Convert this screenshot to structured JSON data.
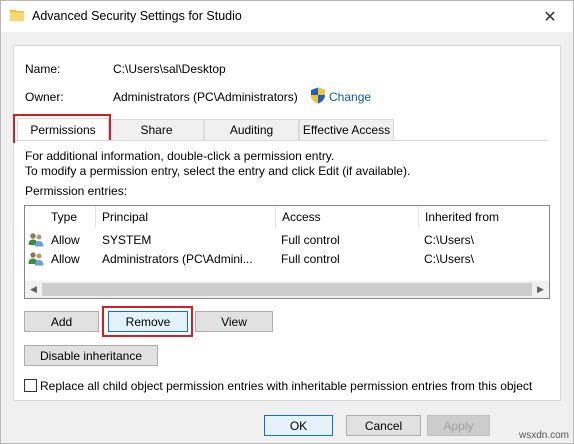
{
  "window": {
    "title": "Advanced Security Settings for Studio",
    "close_glyph": "✕"
  },
  "info": {
    "name_label": "Name:",
    "name_value": "C:\\Users\\sal\\Desktop",
    "owner_label": "Owner:",
    "owner_value": "Administrators (PC\\Administrators)",
    "change_link": "Change"
  },
  "tabs": [
    {
      "label": "Permissions",
      "active": true
    },
    {
      "label": "Share",
      "active": false
    },
    {
      "label": "Auditing",
      "active": false
    },
    {
      "label": "Effective Access",
      "active": false
    }
  ],
  "permissions": {
    "info_line1": "For additional information, double-click a permission entry.",
    "info_line2": "To modify a permission entry, select the entry and click Edit (if available).",
    "entries_label": "Permission entries:",
    "columns": [
      "Type",
      "Principal",
      "Access",
      "Inherited from"
    ],
    "rows": [
      {
        "type": "Allow",
        "principal": "SYSTEM",
        "access": "Full control",
        "inherited": "C:\\Users\\"
      },
      {
        "type": "Allow",
        "principal": "Administrators (PC\\Admini...",
        "access": "Full control",
        "inherited": "C:\\Users\\"
      }
    ],
    "add_button": "Add",
    "remove_button": "Remove",
    "view_button": "View",
    "disable_inheritance_button": "Disable inheritance",
    "replace_checkbox_label": "Replace all child object permission entries with inheritable permission entries from this object",
    "replace_checked": false
  },
  "footer": {
    "ok_button": "OK",
    "cancel_button": "Cancel",
    "apply_button": "Apply"
  },
  "watermark": "wsxdn.com",
  "colors": {
    "highlight": "#d51d26",
    "link": "#0a5bb5",
    "focus_border": "#0078d7"
  }
}
